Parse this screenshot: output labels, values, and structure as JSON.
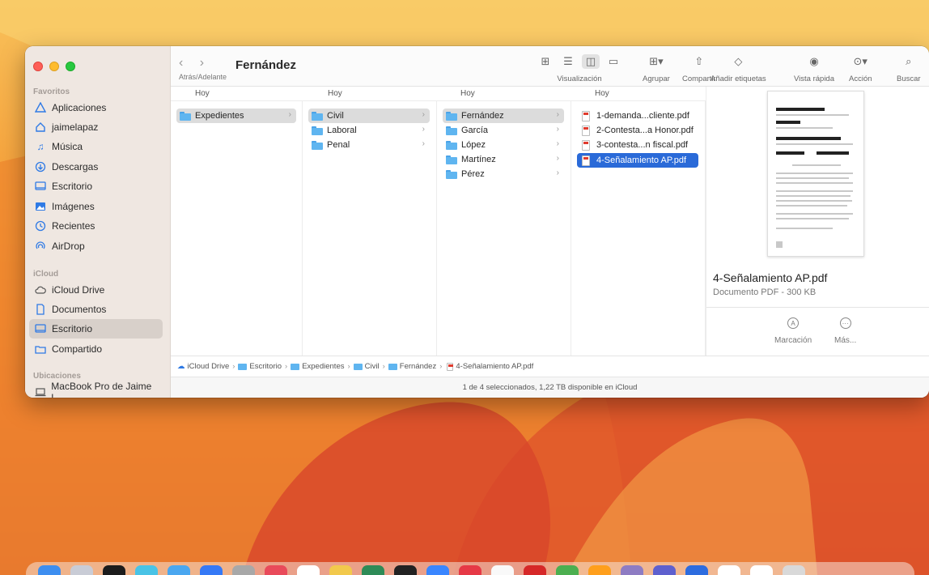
{
  "window": {
    "title": "Fernández",
    "nav_label": "Atrás/Adelante",
    "nav_arrows": "‹ ›"
  },
  "toolbar": {
    "view_label": "Visualización",
    "group_label": "Agrupar",
    "share_label": "Compartir",
    "tags_label": "Añadir etiquetas",
    "quicklook_label": "Vista rápida",
    "action_label": "Acción",
    "search_label": "Buscar"
  },
  "sidebar": {
    "favorites_header": "Favoritos",
    "favorites": [
      {
        "label": "Aplicaciones",
        "icon": "apps-icon"
      },
      {
        "label": "jaimelapaz",
        "icon": "home-icon"
      },
      {
        "label": "Música",
        "icon": "music-icon"
      },
      {
        "label": "Descargas",
        "icon": "download-icon"
      },
      {
        "label": "Escritorio",
        "icon": "desktop-icon"
      },
      {
        "label": "Imágenes",
        "icon": "photos-icon"
      },
      {
        "label": "Recientes",
        "icon": "clock-icon"
      },
      {
        "label": "AirDrop",
        "icon": "airdrop-icon"
      }
    ],
    "icloud_header": "iCloud",
    "icloud": [
      {
        "label": "iCloud Drive",
        "icon": "cloud-icon"
      },
      {
        "label": "Documentos",
        "icon": "document-icon"
      },
      {
        "label": "Escritorio",
        "icon": "desktop-icon"
      },
      {
        "label": "Compartido",
        "icon": "shared-folder-icon"
      }
    ],
    "locations_header": "Ubicaciones",
    "locations": [
      {
        "label": "MacBook Pro de Jaime L...",
        "icon": "laptop-icon"
      }
    ]
  },
  "columns": [
    {
      "header": "Hoy",
      "items": [
        {
          "label": "Expedientes",
          "type": "folder",
          "state": "gray"
        }
      ]
    },
    {
      "header": "Hoy",
      "items": [
        {
          "label": "Civil",
          "type": "folder",
          "state": "gray"
        },
        {
          "label": "Laboral",
          "type": "folder",
          "state": "none"
        },
        {
          "label": "Penal",
          "type": "folder",
          "state": "none"
        }
      ]
    },
    {
      "header": "Hoy",
      "items": [
        {
          "label": "Fernández",
          "type": "folder",
          "state": "gray"
        },
        {
          "label": "García",
          "type": "folder",
          "state": "none"
        },
        {
          "label": "López",
          "type": "folder",
          "state": "none"
        },
        {
          "label": "Martínez",
          "type": "folder",
          "state": "none"
        },
        {
          "label": "Pérez",
          "type": "folder",
          "state": "none"
        }
      ]
    },
    {
      "header": "Hoy",
      "items": [
        {
          "label": "1-demanda...cliente.pdf",
          "type": "pdf",
          "state": "none"
        },
        {
          "label": "2-Contesta...a Honor.pdf",
          "type": "pdf",
          "state": "none"
        },
        {
          "label": "3-contesta...n fiscal.pdf",
          "type": "pdf",
          "state": "none"
        },
        {
          "label": "4-Señalamiento AP.pdf",
          "type": "pdf",
          "state": "blue"
        }
      ]
    }
  ],
  "preview": {
    "filename": "4-Señalamiento AP.pdf",
    "kind": "Documento PDF - 300 KB",
    "markup_label": "Marcación",
    "more_label": "Más..."
  },
  "pathbar": [
    "iCloud Drive",
    "Escritorio",
    "Expedientes",
    "Civil",
    "Fernández",
    "4-Señalamiento AP.pdf"
  ],
  "status": "1 de 4 seleccionados, 1,22 TB disponible en iCloud"
}
